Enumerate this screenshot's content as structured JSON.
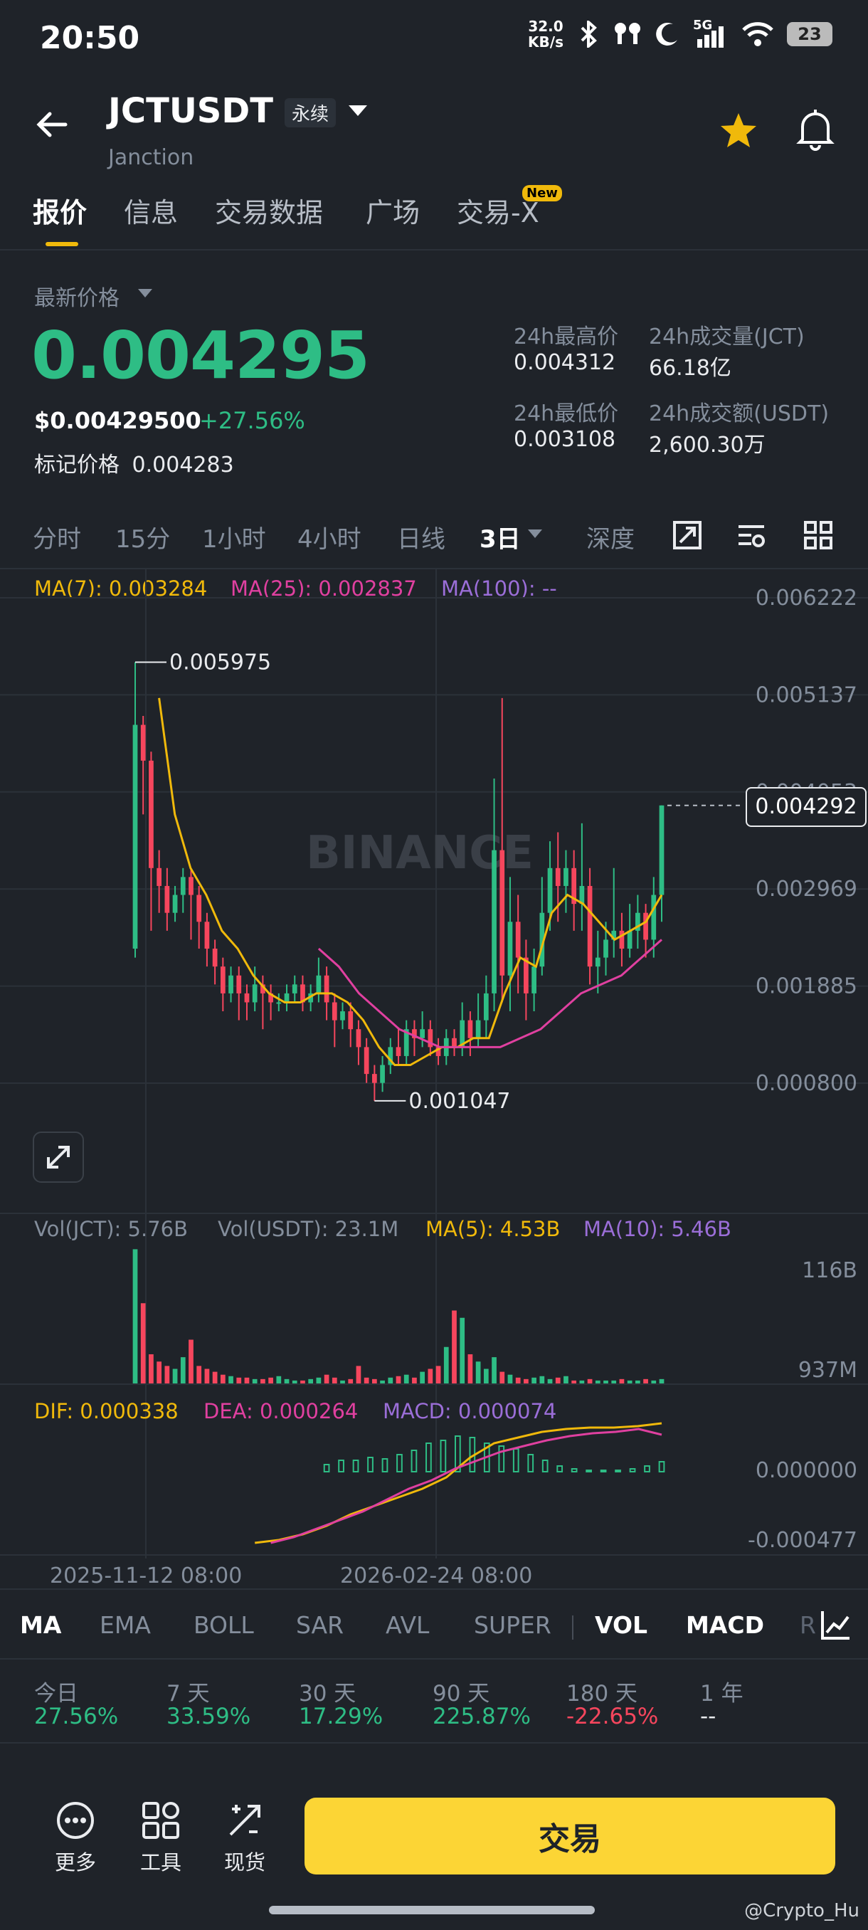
{
  "status_bar": {
    "time": "20:50",
    "net_speed_value": "32.0",
    "net_speed_unit": "KB/s",
    "signal": "5G",
    "battery": "23"
  },
  "header": {
    "symbol": "JCTUSDT",
    "badge": "永续",
    "subtitle": "Janction"
  },
  "tabs": [
    {
      "label": "报价"
    },
    {
      "label": "信息"
    },
    {
      "label": "交易数据"
    },
    {
      "label": "广场"
    },
    {
      "label": "交易-X"
    }
  ],
  "new_badge": "New",
  "price": {
    "label": "最新价格",
    "last": "0.004295",
    "usd": "$0.00429500",
    "change": "+27.56%",
    "mark_label": "标记价格",
    "mark": "0.004283"
  },
  "stats": {
    "high_label": "24h最高价",
    "high": "0.004312",
    "low_label": "24h最低价",
    "low": "0.003108",
    "vol_base_label": "24h成交量(JCT)",
    "vol_base": "66.18亿",
    "vol_quote_label": "24h成交额(USDT)",
    "vol_quote": "2,600.30万"
  },
  "intervals": [
    "分时",
    "15分",
    "1小时",
    "4小时",
    "日线",
    "3日",
    "深度"
  ],
  "ma_legend": {
    "ma7": "MA(7): 0.003284",
    "ma25": "MA(25): 0.002837",
    "ma100": "MA(100): --"
  },
  "price_axis": [
    "0.006222",
    "0.005137",
    "0.004053",
    "0.002969",
    "0.001885",
    "0.000800"
  ],
  "current_price_tag": "0.004292",
  "high_annotation": "0.005975",
  "low_annotation": "0.001047",
  "watermark": "BINANCE",
  "vol_legend": {
    "vol_base": "Vol(JCT): 5.76B",
    "vol_quote": "Vol(USDT): 23.1M",
    "ma5": "MA(5): 4.53B",
    "ma10": "MA(10): 5.46B"
  },
  "vol_axis": [
    "116B",
    "937M"
  ],
  "macd_legend": {
    "dif": "DIF: 0.000338",
    "dea": "DEA: 0.000264",
    "macd": "MACD: 0.000074"
  },
  "macd_axis": [
    "0.000000",
    "-0.000477"
  ],
  "time_axis": [
    "2025-11-12 08:00",
    "2026-02-24 08:00"
  ],
  "indicators": [
    "MA",
    "EMA",
    "BOLL",
    "SAR",
    "AVL",
    "SUPER",
    "VOL",
    "MACD",
    "R"
  ],
  "performance": [
    {
      "label": "今日",
      "value": "27.56%"
    },
    {
      "label": "7 天",
      "value": "33.59%"
    },
    {
      "label": "30 天",
      "value": "17.29%"
    },
    {
      "label": "90 天",
      "value": "225.87%"
    },
    {
      "label": "180 天",
      "value": "-22.65%"
    },
    {
      "label": "1 年",
      "value": "--"
    }
  ],
  "bottom_bar": {
    "more": "更多",
    "tools": "工具",
    "spot": "现货",
    "trade": "交易"
  },
  "credit": "@Crypto_Hu",
  "colors": {
    "up": "#2ebd85",
    "down": "#f6465d",
    "accent": "#fcd535",
    "ma7": "#f0b90b",
    "ma25": "#e040a0",
    "ma100": "#9b6ed8"
  },
  "chart_data": {
    "type": "candlestick",
    "y_range": [
      0.0008,
      0.006222
    ],
    "candles": [
      [
        0.0027,
        0.0052,
        0.0026,
        0.0059
      ],
      [
        0.0052,
        0.0048,
        0.0042,
        0.0053
      ],
      [
        0.0048,
        0.0036,
        0.0029,
        0.0049
      ],
      [
        0.0036,
        0.0034,
        0.0031,
        0.0038
      ],
      [
        0.0034,
        0.0031,
        0.0029,
        0.0036
      ],
      [
        0.0031,
        0.0033,
        0.003,
        0.0034
      ],
      [
        0.0033,
        0.0035,
        0.0031,
        0.0036
      ],
      [
        0.0035,
        0.0033,
        0.0028,
        0.0036
      ],
      [
        0.0033,
        0.003,
        0.0027,
        0.0034
      ],
      [
        0.003,
        0.0027,
        0.0025,
        0.0031
      ],
      [
        0.0027,
        0.0025,
        0.0023,
        0.0028
      ],
      [
        0.0025,
        0.0022,
        0.002,
        0.0026
      ],
      [
        0.0022,
        0.0024,
        0.0021,
        0.0025
      ],
      [
        0.0024,
        0.0022,
        0.0019,
        0.0025
      ],
      [
        0.0022,
        0.0021,
        0.0019,
        0.0023
      ],
      [
        0.0021,
        0.0023,
        0.002,
        0.0025
      ],
      [
        0.0023,
        0.0022,
        0.0018,
        0.0024
      ],
      [
        0.0022,
        0.0021,
        0.0019,
        0.0023
      ],
      [
        0.0021,
        0.0021,
        0.002,
        0.0022
      ],
      [
        0.0021,
        0.0022,
        0.002,
        0.0023
      ],
      [
        0.0022,
        0.0023,
        0.0021,
        0.0024
      ],
      [
        0.0023,
        0.0021,
        0.002,
        0.0024
      ],
      [
        0.0021,
        0.0022,
        0.002,
        0.0023
      ],
      [
        0.0022,
        0.0024,
        0.0021,
        0.0026
      ],
      [
        0.0024,
        0.0021,
        0.0019,
        0.0025
      ],
      [
        0.0021,
        0.0019,
        0.0016,
        0.0022
      ],
      [
        0.0019,
        0.002,
        0.0018,
        0.0021
      ],
      [
        0.002,
        0.0018,
        0.0016,
        0.0021
      ],
      [
        0.0018,
        0.0016,
        0.0014,
        0.0019
      ],
      [
        0.0016,
        0.0013,
        0.0012,
        0.0017
      ],
      [
        0.0013,
        0.0012,
        0.001,
        0.0014
      ],
      [
        0.0012,
        0.0014,
        0.0011,
        0.0015
      ],
      [
        0.0014,
        0.0016,
        0.0013,
        0.0017
      ],
      [
        0.0016,
        0.0015,
        0.0014,
        0.0018
      ],
      [
        0.0015,
        0.0018,
        0.0014,
        0.0019
      ],
      [
        0.0018,
        0.0017,
        0.0015,
        0.0019
      ],
      [
        0.0017,
        0.0018,
        0.0016,
        0.002
      ],
      [
        0.0018,
        0.0016,
        0.0015,
        0.0019
      ],
      [
        0.0016,
        0.0015,
        0.0014,
        0.0017
      ],
      [
        0.0015,
        0.0017,
        0.0014,
        0.0018
      ],
      [
        0.0017,
        0.0016,
        0.0015,
        0.0018
      ],
      [
        0.0016,
        0.0019,
        0.0015,
        0.0021
      ],
      [
        0.0019,
        0.0017,
        0.0015,
        0.002
      ],
      [
        0.0017,
        0.0019,
        0.0016,
        0.0022
      ],
      [
        0.0019,
        0.0022,
        0.0017,
        0.0024
      ],
      [
        0.0022,
        0.0038,
        0.002,
        0.0046
      ],
      [
        0.0038,
        0.0024,
        0.0021,
        0.0055
      ],
      [
        0.0024,
        0.003,
        0.002,
        0.0035
      ],
      [
        0.003,
        0.0026,
        0.0022,
        0.0033
      ],
      [
        0.0026,
        0.0022,
        0.0019,
        0.0028
      ],
      [
        0.0022,
        0.0025,
        0.002,
        0.0027
      ],
      [
        0.0025,
        0.0031,
        0.0024,
        0.0035
      ],
      [
        0.0031,
        0.0036,
        0.0029,
        0.0039
      ],
      [
        0.0036,
        0.0034,
        0.003,
        0.004
      ],
      [
        0.0034,
        0.0036,
        0.0031,
        0.0038
      ],
      [
        0.0036,
        0.0032,
        0.0029,
        0.0038
      ],
      [
        0.0032,
        0.0034,
        0.0029,
        0.0041
      ],
      [
        0.0034,
        0.0025,
        0.0023,
        0.0036
      ],
      [
        0.0025,
        0.0026,
        0.0022,
        0.0029
      ],
      [
        0.0026,
        0.0028,
        0.0024,
        0.003
      ],
      [
        0.0028,
        0.0029,
        0.0026,
        0.0036
      ],
      [
        0.0029,
        0.0027,
        0.0025,
        0.0031
      ],
      [
        0.0027,
        0.0029,
        0.0026,
        0.0032
      ],
      [
        0.0029,
        0.0031,
        0.0027,
        0.0033
      ],
      [
        0.0031,
        0.0028,
        0.0026,
        0.0032
      ],
      [
        0.0028,
        0.0033,
        0.0026,
        0.0035
      ],
      [
        0.0033,
        0.0043,
        0.003,
        0.0043
      ]
    ],
    "ma7": [
      0.0055,
      0.0042,
      0.0036,
      0.0033,
      0.0029,
      0.0027,
      0.0024,
      0.0022,
      0.0021,
      0.0021,
      0.0022,
      0.0022,
      0.0021,
      0.0019,
      0.0016,
      0.0014,
      0.0014,
      0.0015,
      0.0016,
      0.0016,
      0.0017,
      0.0017,
      0.0022,
      0.0026,
      0.0025,
      0.0031,
      0.0033,
      0.0032,
      0.003,
      0.0028,
      0.0029,
      0.003,
      0.0033
    ],
    "ma25": [
      0.0027,
      0.0025,
      0.0022,
      0.002,
      0.0018,
      0.0017,
      0.0016,
      0.0016,
      0.0016,
      0.0016,
      0.0017,
      0.0018,
      0.002,
      0.0022,
      0.0023,
      0.0024,
      0.0026,
      0.0028
    ],
    "volume": [
      0.92,
      0.55,
      0.2,
      0.15,
      0.12,
      0.1,
      0.18,
      0.3,
      0.12,
      0.1,
      0.08,
      0.06,
      0.05,
      0.04,
      0.04,
      0.03,
      0.03,
      0.04,
      0.05,
      0.03,
      0.02,
      0.02,
      0.03,
      0.04,
      0.06,
      0.04,
      0.02,
      0.03,
      0.12,
      0.04,
      0.03,
      0.02,
      0.04,
      0.05,
      0.06,
      0.04,
      0.08,
      0.1,
      0.12,
      0.25,
      0.5,
      0.45,
      0.2,
      0.15,
      0.1,
      0.18,
      0.08,
      0.06,
      0.04,
      0.03,
      0.04,
      0.05,
      0.03,
      0.04,
      0.05,
      0.02,
      0.02,
      0.03,
      0.02,
      0.02,
      0.02,
      0.03,
      0.02,
      0.02,
      0.03,
      0.02,
      0.03
    ],
    "macd_hist": [
      5e-05,
      8e-05,
      8e-05,
      0.0001,
      9e-05,
      0.00012,
      0.00015,
      0.0002,
      0.00022,
      0.00025,
      0.00024,
      0.0002,
      0.00018,
      0.00016,
      0.00012,
      8e-05,
      4e-05,
      2e-05,
      1e-05,
      1e-05,
      1e-05,
      2e-05,
      4e-05,
      7e-05
    ],
    "dif": [
      -0.0005,
      -0.00048,
      -0.00044,
      -0.00038,
      -0.0003,
      -0.00024,
      -0.00018,
      -0.00012,
      -4e-05,
      0.0001,
      0.0002,
      0.00024,
      0.00028,
      0.0003,
      0.00031,
      0.00031,
      0.00032,
      0.00034
    ],
    "dea": [
      -0.0005,
      -0.00046,
      -0.0004,
      -0.00034,
      -0.00028,
      -0.0002,
      -0.00012,
      -6e-05,
      2e-05,
      8e-05,
      0.00014,
      0.00018,
      0.00022,
      0.00025,
      0.00027,
      0.00028,
      0.0003,
      0.00026
    ]
  }
}
